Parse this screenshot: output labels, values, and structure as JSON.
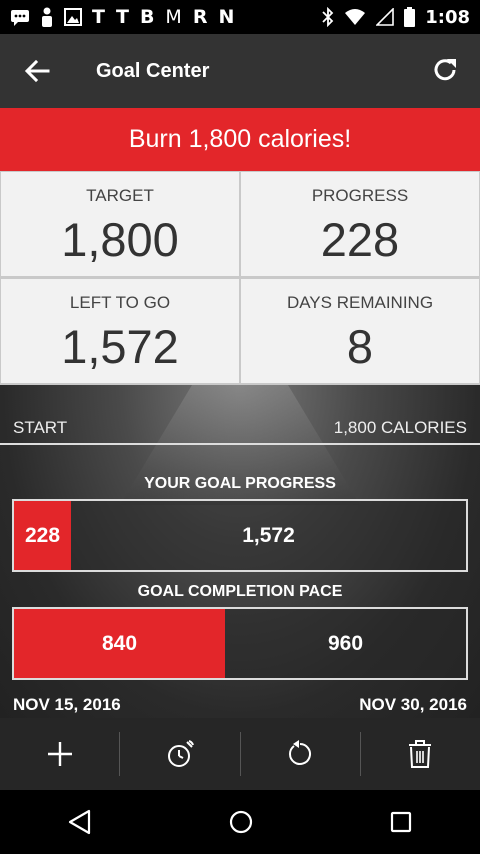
{
  "status_bar": {
    "left_icons": [
      "message-icon",
      "person-icon",
      "image-icon"
    ],
    "left_letters": [
      "T",
      "T",
      "B",
      "M",
      "R",
      "N"
    ],
    "right_icons": [
      "bluetooth-icon",
      "wifi-icon",
      "signal-icon",
      "battery-icon"
    ],
    "time": "1:08"
  },
  "app_bar": {
    "title": "Goal Center",
    "back_icon": "arrow-left-icon",
    "refresh_icon": "refresh-icon"
  },
  "banner": {
    "text": "Burn 1,800 calories!",
    "color": "#e3262a"
  },
  "stats": {
    "target": {
      "label": "TARGET",
      "value": "1,800"
    },
    "progress": {
      "label": "PROGRESS",
      "value": "228"
    },
    "left_to_go": {
      "label": "LEFT TO GO",
      "value": "1,572"
    },
    "days_remaining": {
      "label": "DAYS REMAINING",
      "value": "8"
    }
  },
  "scale": {
    "start": "START",
    "end": "1,800 CALORIES"
  },
  "goal_progress": {
    "title": "YOUR GOAL PROGRESS",
    "done": "228",
    "remaining": "1,572",
    "fraction": 0.127
  },
  "completion_pace": {
    "title": "GOAL COMPLETION PACE",
    "done": "840",
    "remaining": "960",
    "fraction": 0.467
  },
  "dates": {
    "start": "NOV 15, 2016",
    "end": "NOV 30, 2016"
  },
  "toolbar": {
    "icons": [
      "add-icon",
      "timer-icon",
      "reset-icon",
      "trash-icon"
    ]
  },
  "nav_bar": {
    "icons": [
      "back-triangle-icon",
      "home-circle-icon",
      "recents-square-icon"
    ]
  },
  "colors": {
    "accent": "#e3262a",
    "app_bar": "#333333",
    "toolbar": "#262626"
  }
}
